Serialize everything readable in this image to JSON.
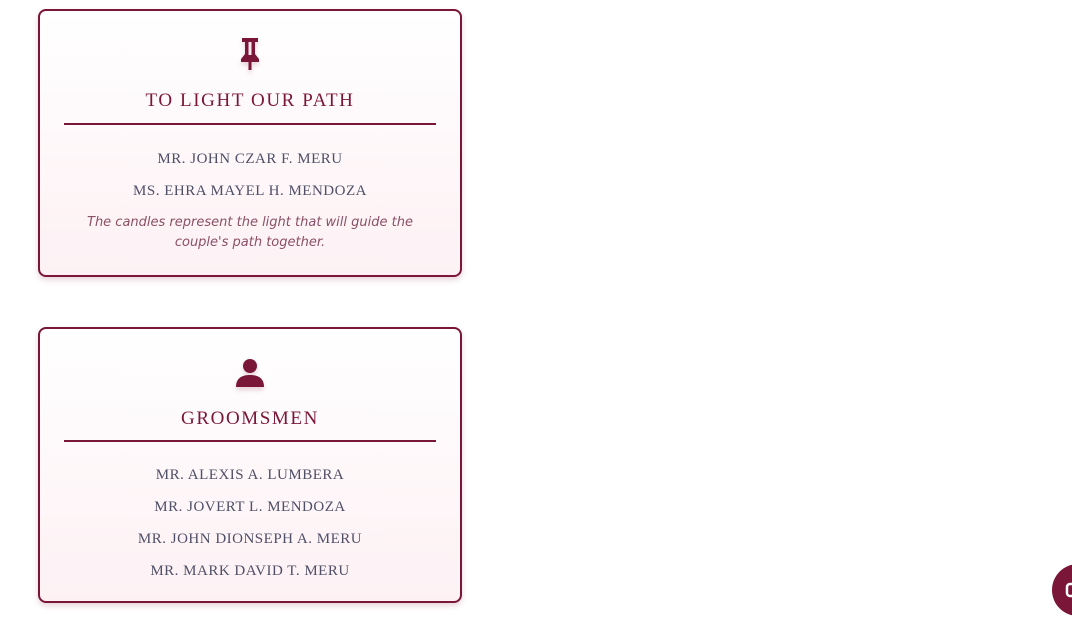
{
  "colors": {
    "accent": "#7a1638",
    "name_text": "#4f4f67",
    "note_text": "#8b4f66",
    "card_background": "#fdf1f4"
  },
  "cards": [
    {
      "icon": "pushpin-icon",
      "title": "TO LIGHT OUR PATH",
      "names": [
        "MR. JOHN CZAR F. MERU",
        "MS. EHRA MAYEL H. MENDOZA"
      ],
      "note": "The candles represent the light that will guide the couple's path together."
    },
    {
      "icon": "person-icon",
      "title": "GROOMSMEN",
      "names": [
        "MR. ALEXIS A. LUMBERA",
        "MR. JOVERT L. MENDOZA",
        "MR. JOHN DIONSEPH A. MERU",
        "MR. MARK DAVID T. MERU"
      ]
    }
  ],
  "floating_button": {
    "icon": "floating-action-icon"
  }
}
